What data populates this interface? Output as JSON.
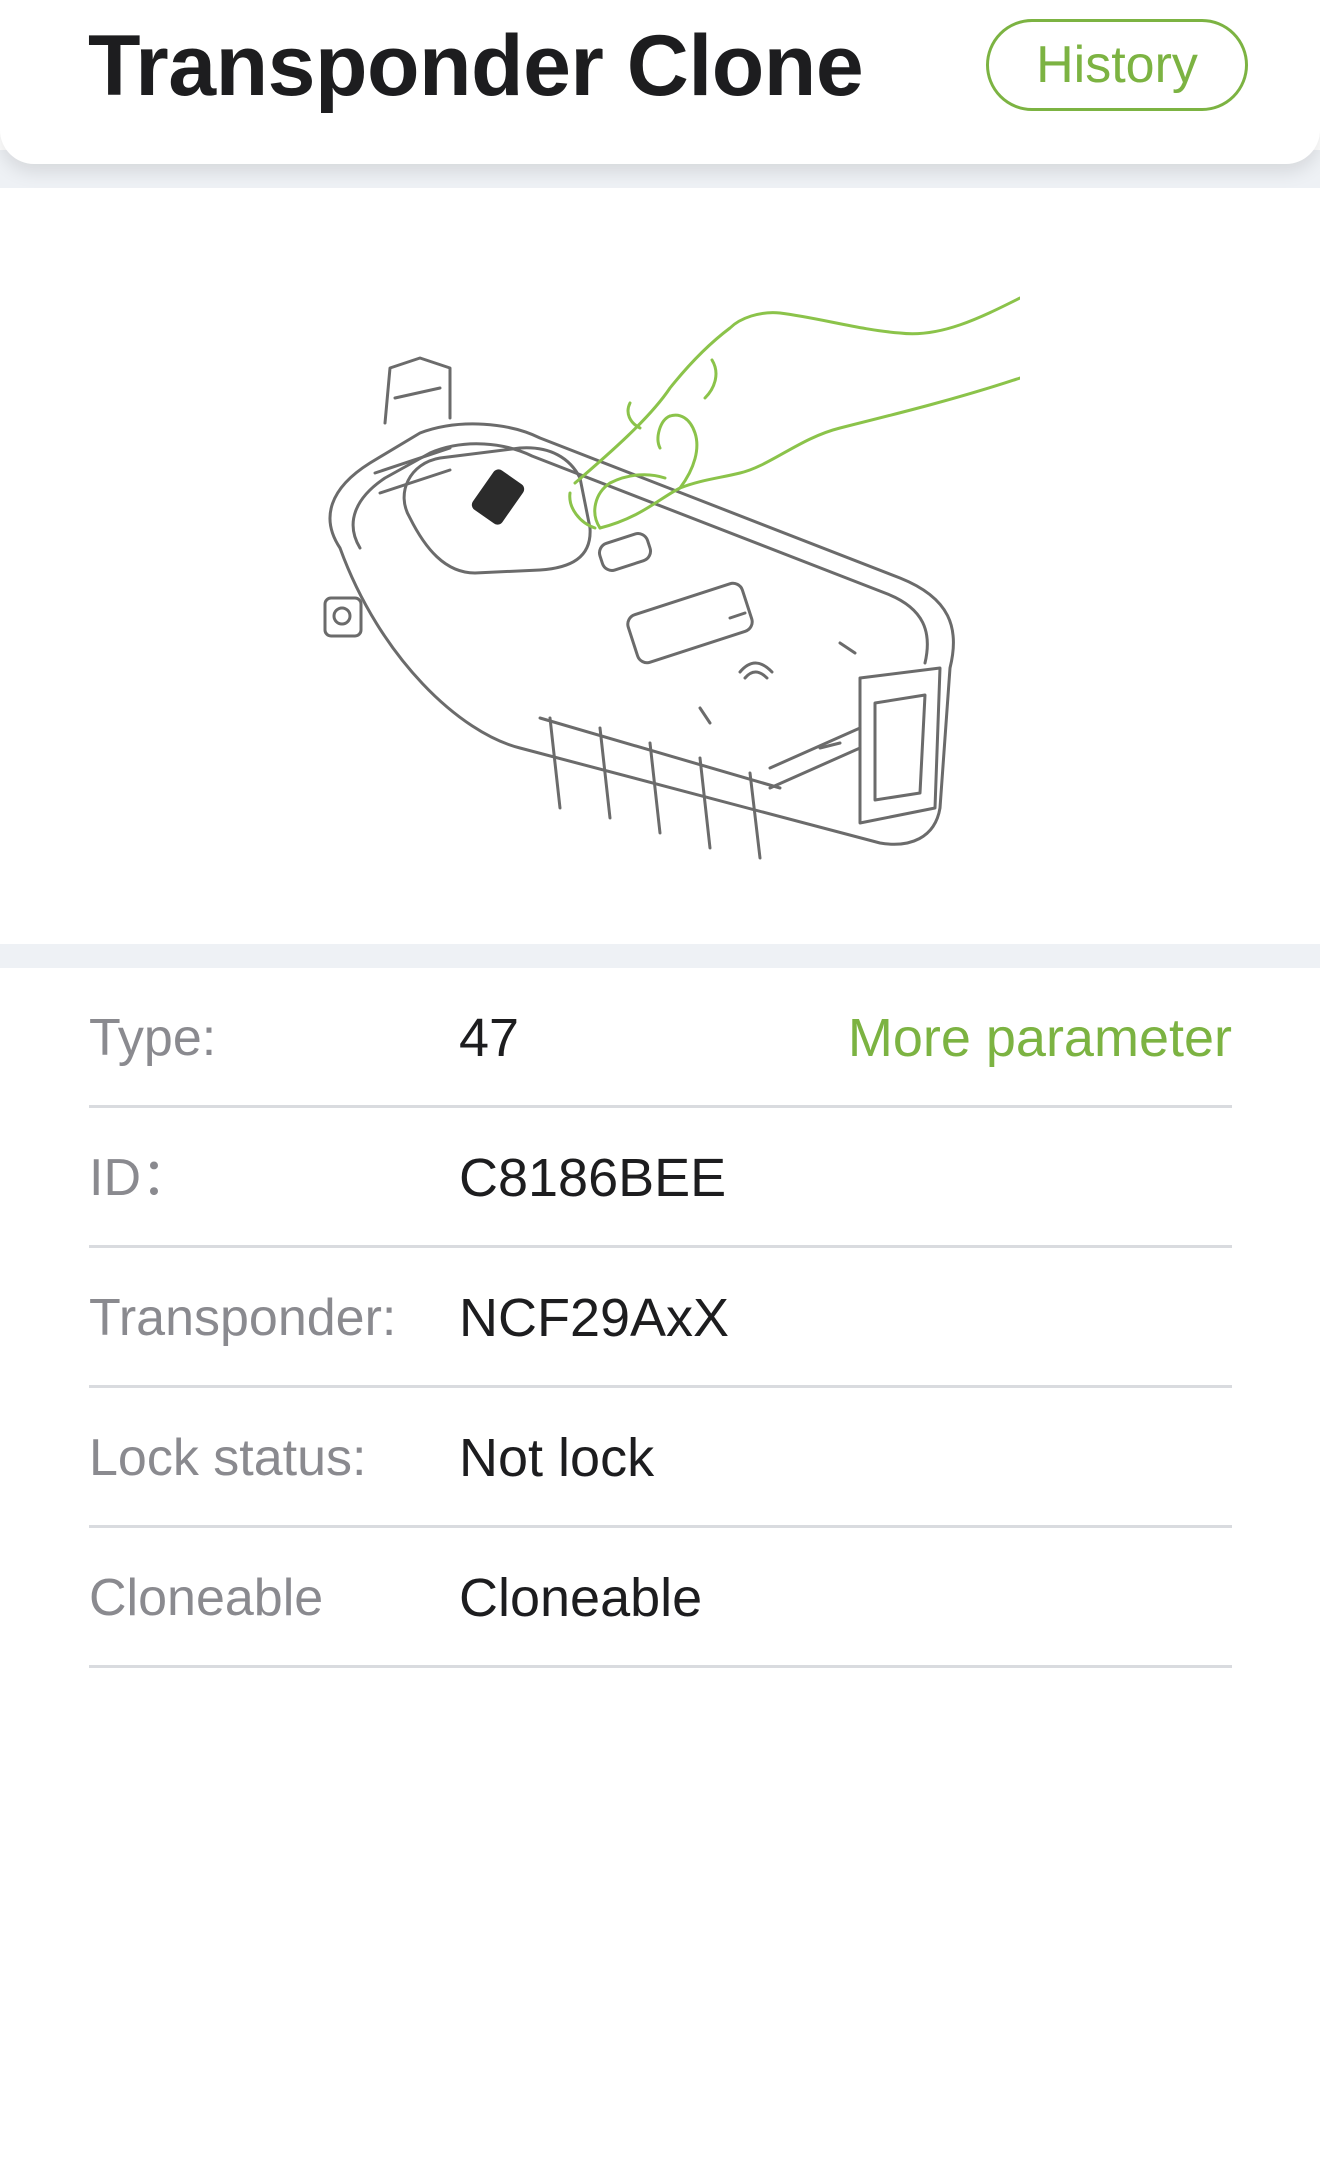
{
  "header": {
    "title": "Transponder Clone",
    "history_label": "History"
  },
  "illustration": {
    "icon": "hand-placing-key-on-device-illustration",
    "colors": {
      "device_stroke": "#6b6b6b",
      "hand_stroke": "#8bc34a",
      "key_fill": "#2b2b2b"
    }
  },
  "info": {
    "more_parameter_label": "More parameter",
    "rows": [
      {
        "label": "Type:",
        "value": "47"
      },
      {
        "label": "ID：",
        "value": "C8186BEE"
      },
      {
        "label": "Transponder:",
        "value": "NCF29AxX"
      },
      {
        "label": "Lock status:",
        "value": "Not lock"
      },
      {
        "label": "Cloneable",
        "value": "Cloneable"
      }
    ]
  },
  "colors": {
    "accent": "#7cb342",
    "label_gray": "#8a8a8f",
    "text_dark": "#1d1d1f",
    "band_bg": "#eef1f5"
  }
}
